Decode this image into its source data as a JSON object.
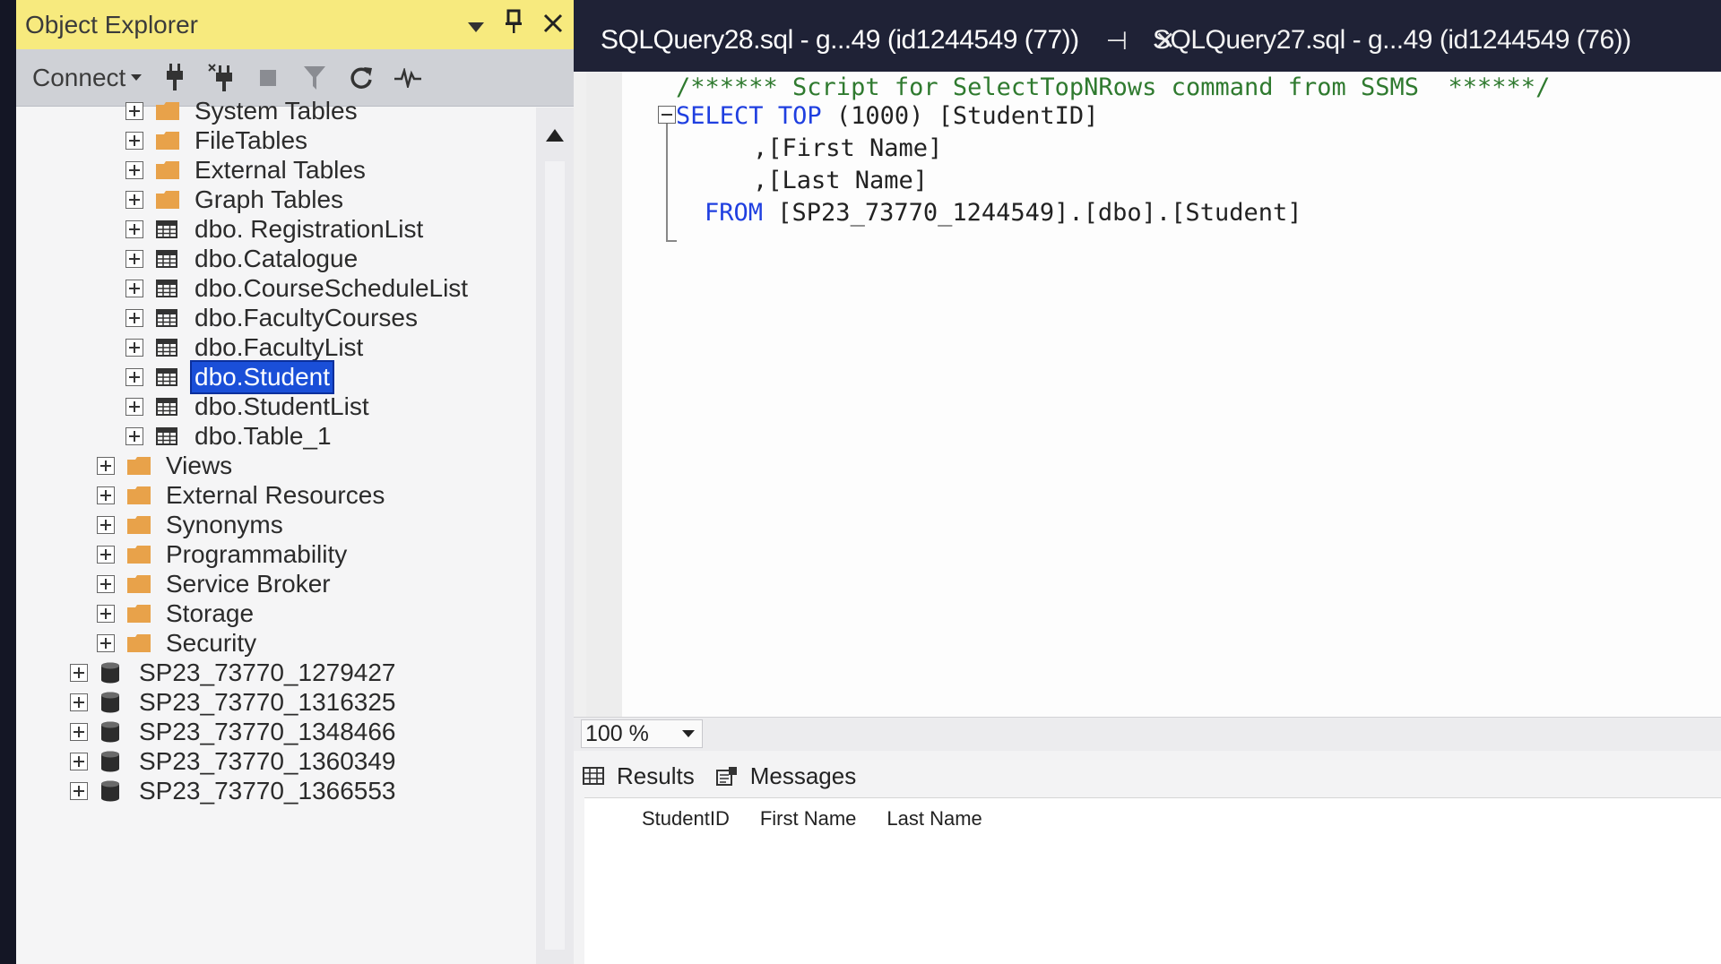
{
  "object_explorer": {
    "title": "Object Explorer",
    "toolbar": {
      "connect_label": "Connect"
    },
    "tree": [
      {
        "label": "System Tables",
        "icon": "folder-icon",
        "level": 2
      },
      {
        "label": "FileTables",
        "icon": "folder-icon",
        "level": 2
      },
      {
        "label": "External Tables",
        "icon": "folder-icon",
        "level": 2
      },
      {
        "label": "Graph Tables",
        "icon": "folder-icon",
        "level": 2
      },
      {
        "label": "dbo. RegistrationList",
        "icon": "table-icon",
        "level": 2
      },
      {
        "label": "dbo.Catalogue",
        "icon": "table-icon",
        "level": 2
      },
      {
        "label": "dbo.CourseScheduleList",
        "icon": "table-icon",
        "level": 2
      },
      {
        "label": "dbo.FacultyCourses",
        "icon": "table-icon",
        "level": 2
      },
      {
        "label": "dbo.FacultyList",
        "icon": "table-icon",
        "level": 2
      },
      {
        "label": "dbo.Student",
        "icon": "table-icon",
        "level": 2,
        "selected": true
      },
      {
        "label": "dbo.StudentList",
        "icon": "table-icon",
        "level": 2
      },
      {
        "label": "dbo.Table_1",
        "icon": "table-icon",
        "level": 2
      },
      {
        "label": "Views",
        "icon": "folder-icon",
        "level": 1
      },
      {
        "label": "External Resources",
        "icon": "folder-icon",
        "level": 1
      },
      {
        "label": "Synonyms",
        "icon": "folder-icon",
        "level": 1
      },
      {
        "label": "Programmability",
        "icon": "folder-icon",
        "level": 1
      },
      {
        "label": "Service Broker",
        "icon": "folder-icon",
        "level": 1
      },
      {
        "label": "Storage",
        "icon": "folder-icon",
        "level": 1
      },
      {
        "label": "Security",
        "icon": "folder-icon",
        "level": 1
      },
      {
        "label": "SP23_73770_1279427",
        "icon": "database-icon",
        "level": 0
      },
      {
        "label": "SP23_73770_1316325",
        "icon": "database-icon",
        "level": 0
      },
      {
        "label": "SP23_73770_1348466",
        "icon": "database-icon",
        "level": 0
      },
      {
        "label": "SP23_73770_1360349",
        "icon": "database-icon",
        "level": 0
      },
      {
        "label": "SP23_73770_1366553",
        "icon": "database-icon",
        "level": 0
      }
    ]
  },
  "tabs": [
    {
      "label": "SQLQuery28.sql - g...49 (id1244549 (77))",
      "active": true
    },
    {
      "label": "SQLQuery27.sql - g...49 (id1244549 (76))",
      "active": false
    }
  ],
  "editor": {
    "comment": "/****** Script for SelectTopNRows command from SSMS  ******/",
    "line1_kw1": "SELECT",
    "line1_kw2": "TOP",
    "line1_rest": " (1000) [StudentID]",
    "line2": ",[First Name]",
    "line3": ",[Last Name]",
    "line4_kw": "FROM",
    "line4_rest": " [SP23_73770_1244549].[dbo].[Student]"
  },
  "zoom": "100 %",
  "results": {
    "tabs": [
      "Results",
      "Messages"
    ],
    "columns": [
      "StudentID",
      "First Name",
      "Last Name"
    ]
  },
  "colors": {
    "oe_title_bg": "#f7ea7e",
    "selection": "#1a4fd8",
    "keyword": "#1f3fe0",
    "folder": "#e8a24a"
  }
}
